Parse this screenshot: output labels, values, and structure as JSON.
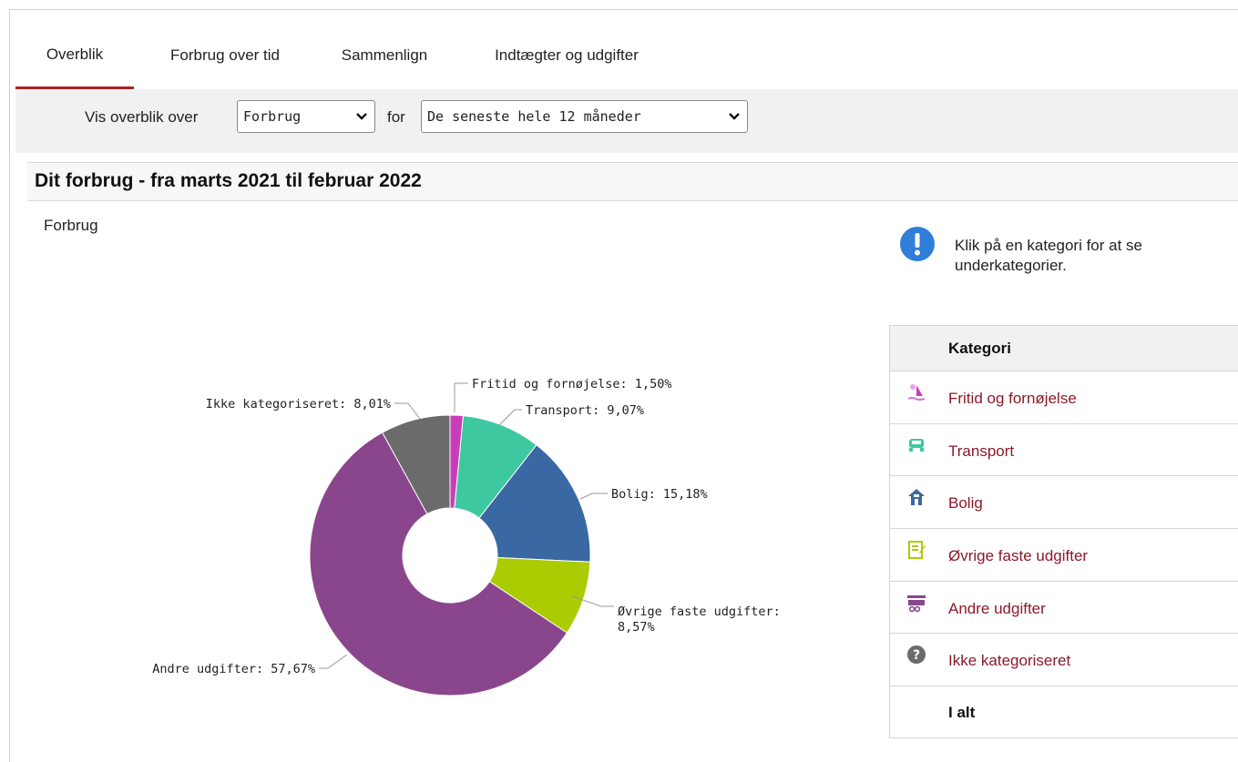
{
  "tabs": [
    {
      "label": "Overblik",
      "active": true
    },
    {
      "label": "Forbrug over tid",
      "active": false
    },
    {
      "label": "Sammenlign",
      "active": false
    },
    {
      "label": "Indtægter og udgifter",
      "active": false
    }
  ],
  "filter": {
    "prefix": "Vis overblik over",
    "type_value": "Forbrug",
    "for_label": "for",
    "period_value": "De seneste hele 12 måneder"
  },
  "panel": {
    "title": "Dit forbrug - fra marts 2021 til februar 2022",
    "chart_label": "Forbrug"
  },
  "info": {
    "text": "Klik på en kategori for at se underkategorier."
  },
  "table": {
    "header": "Kategori",
    "rows": [
      {
        "label": "Fritid og fornøjelse",
        "icon": "leisure-icon"
      },
      {
        "label": "Transport",
        "icon": "car-icon"
      },
      {
        "label": "Bolig",
        "icon": "house-icon"
      },
      {
        "label": "Øvrige faste udgifter",
        "icon": "bill-icon"
      },
      {
        "label": "Andre udgifter",
        "icon": "shopping-cart-icon"
      },
      {
        "label": "Ikke kategoriseret",
        "icon": "question-icon"
      }
    ],
    "total": "I alt"
  },
  "colors": {
    "accent": "#a52525",
    "link": "#8a1a2b",
    "info": "#2f7fd8"
  },
  "chart_data": {
    "type": "pie",
    "donut": true,
    "start_angle_deg": 0,
    "direction": "clockwise",
    "slices": [
      {
        "name": "Fritid og fornøjelse",
        "value": 1.5,
        "label": "Fritid og fornøjelse: 1,50%",
        "color": "#c93dba"
      },
      {
        "name": "Transport",
        "value": 9.07,
        "label": "Transport: 9,07%",
        "color": "#3ec89f"
      },
      {
        "name": "Bolig",
        "value": 15.18,
        "label": "Bolig: 15,18%",
        "color": "#3a68a2"
      },
      {
        "name": "Øvrige faste udgifter",
        "value": 8.57,
        "label": "Øvrige faste udgifter:",
        "label2": "8,57%",
        "color": "#aacc00"
      },
      {
        "name": "Andre udgifter",
        "value": 57.67,
        "label": "Andre udgifter: 57,67%",
        "color": "#8a468d"
      },
      {
        "name": "Ikke kategoriseret",
        "value": 8.01,
        "label": "Ikke kategoriseret: 8,01%",
        "color": "#6b6b6b"
      }
    ]
  }
}
